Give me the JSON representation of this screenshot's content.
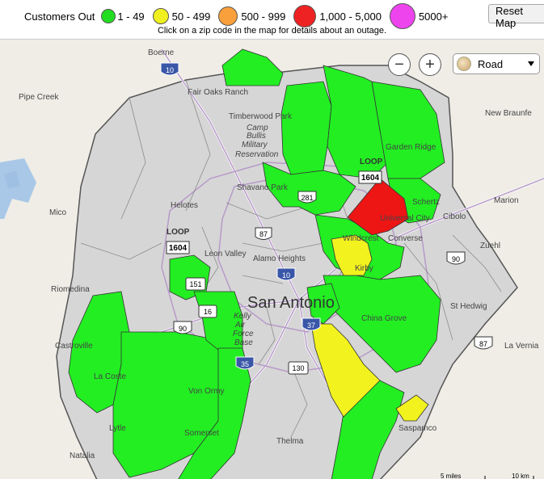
{
  "legend": {
    "title": "Customers Out",
    "items": [
      {
        "label": "1 - 49",
        "color": "#22dd22"
      },
      {
        "label": "50 - 499",
        "color": "#f0f020"
      },
      {
        "label": "500 - 999",
        "color": "#f9a03c"
      },
      {
        "label": "1,000 - 5,000",
        "color": "#ee2222"
      },
      {
        "label": "5000+",
        "color": "#ee44ee"
      }
    ]
  },
  "reset_button": "Reset Map",
  "instruction": "Click on a zip code in the map for details about an outage.",
  "map_controls": {
    "zoom_out": "−",
    "zoom_in": "+",
    "map_type": "Road"
  },
  "places": {
    "boerne": "Boerne",
    "pipe_creek": "Pipe Creek",
    "fair_oaks_ranch": "Fair Oaks Ranch",
    "timberwood_park": "Timberwood Park",
    "camp_bullis": [
      "Camp",
      "Bullis",
      "Military",
      "Reservation"
    ],
    "new_braunfels": "New Braunfe",
    "garden_ridge": "Garden Ridge",
    "loop_top": "LOOP",
    "loop_left": "LOOP",
    "shavano_park": "Shavano Park",
    "schertz": "Schertz",
    "marion": "Marion",
    "mico": "Mico",
    "helotes": "Helotes",
    "universal_city": "Universal City",
    "cibolo": "Cibolo",
    "windcrest": "Windcrest",
    "converse": "Converse",
    "zuehl": "Zuehl",
    "leon_valley": "Leon Valley",
    "alamo_heights": "Alamo Heights",
    "kirby": "Kirby",
    "riomedina": "Riomedina",
    "san_antonio": "San Antonio",
    "st_hedwig": "St Hedwig",
    "kelly": [
      "Kelly",
      "Air",
      "Force",
      "Base"
    ],
    "china_grove": "China Grove",
    "castroville": "Castroville",
    "la_vernia": "La Vernia",
    "la_coste": "La Coste",
    "von_ormy": "Von Ormy",
    "lytle": "Lytle",
    "somerset": "Somerset",
    "sandy_oaks": "Saspamco",
    "natalia": "Natalia",
    "thelma": "Thelma"
  },
  "shields": {
    "i10_north": "10",
    "loop1604_top": "1604",
    "us281": "281",
    "i87": "87",
    "loop1604_left": "1604",
    "i10_center": "10",
    "sh151": "151",
    "sh16": "16",
    "us90_left": "90",
    "i37": "37",
    "i35": "35",
    "sh130": "130",
    "us90_right": "90",
    "us87_right": "87"
  },
  "scale": {
    "left": "5 miles",
    "right": "10 km"
  }
}
